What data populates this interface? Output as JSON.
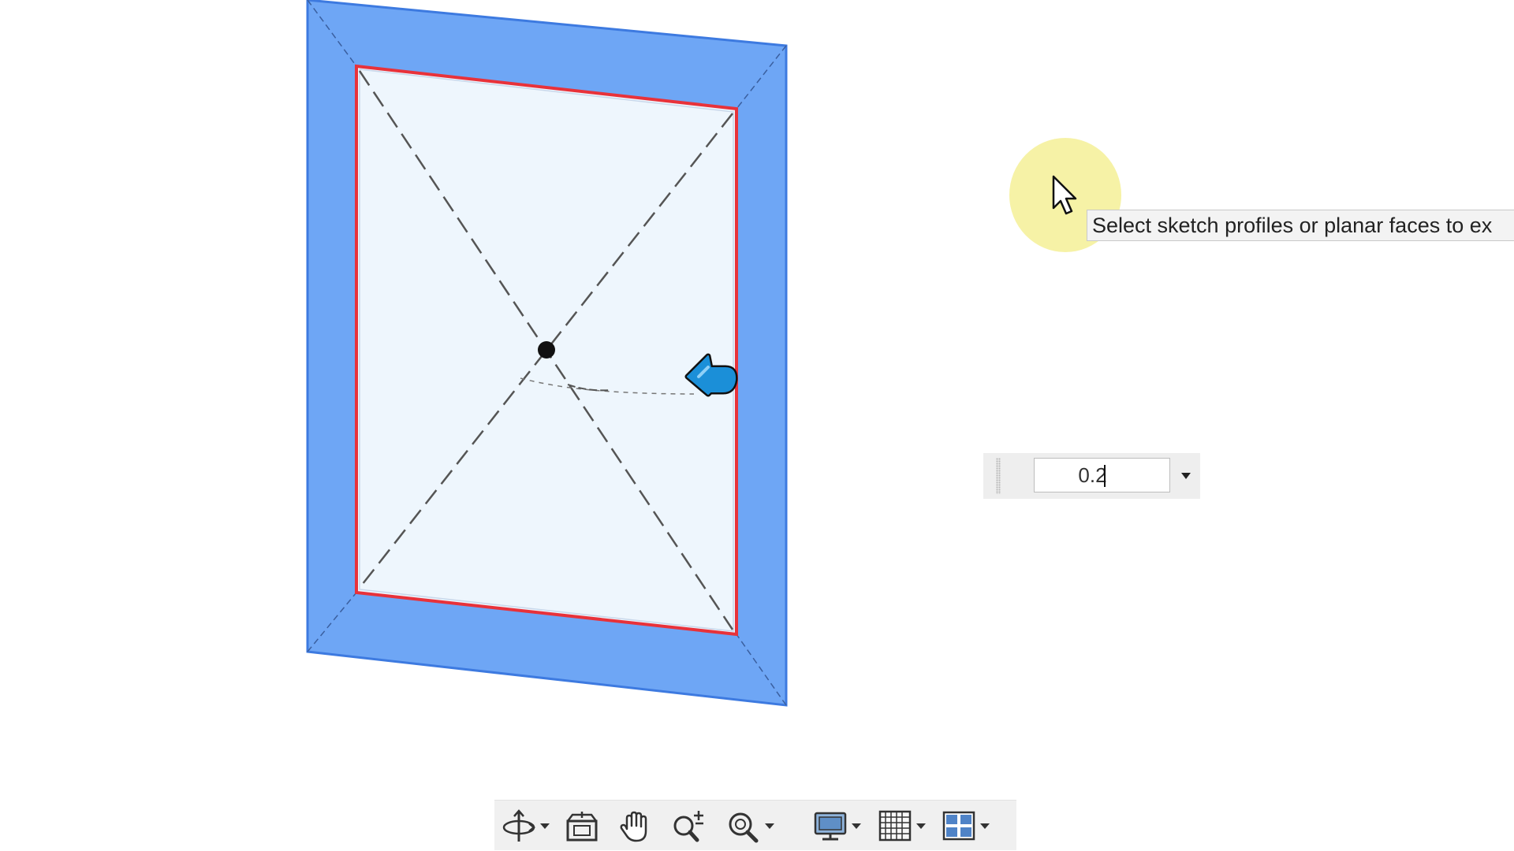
{
  "tooltip": {
    "text": "Select sketch profiles or planar faces to ex"
  },
  "value_input": {
    "value": "0.2"
  },
  "colors": {
    "frame_fill": "#6ea6f5",
    "frame_edge": "#3d7ae0",
    "panel_fill": "#eef6fd",
    "profile_highlight": "#e8323a",
    "direction_arrow": "#1b8fd8",
    "cursor_highlight": "#f5f096",
    "toolbar_bg": "#f0f0f0"
  },
  "navbar": {
    "items": [
      {
        "icon": "orbit-icon",
        "has_dropdown": true
      },
      {
        "icon": "view-cube-icon",
        "has_dropdown": false
      },
      {
        "icon": "pan-hand-icon",
        "has_dropdown": false
      },
      {
        "icon": "zoom-in-icon",
        "has_dropdown": false
      },
      {
        "icon": "zoom-window-icon",
        "has_dropdown": true
      },
      {
        "icon": "display-style-icon",
        "has_dropdown": true
      },
      {
        "icon": "grid-icon",
        "has_dropdown": true
      },
      {
        "icon": "viewports-icon",
        "has_dropdown": true
      }
    ]
  }
}
